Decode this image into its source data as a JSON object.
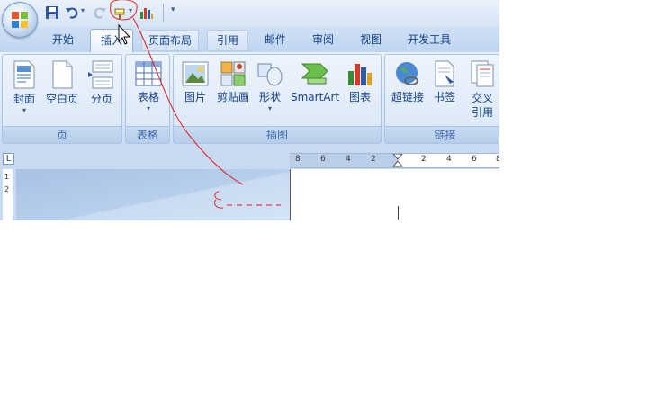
{
  "quick_access": {
    "icons": [
      "save-icon",
      "undo-icon",
      "redo-icon",
      "format-painter-icon",
      "chart-icon",
      "customize-icon"
    ]
  },
  "tabs": [
    {
      "label": "开始"
    },
    {
      "label": "插入"
    },
    {
      "label": "页面布局"
    },
    {
      "label": "引用"
    },
    {
      "label": "邮件"
    },
    {
      "label": "审阅"
    },
    {
      "label": "视图"
    },
    {
      "label": "开发工具"
    }
  ],
  "active_tab": "插入",
  "groups": {
    "pages": {
      "label": "页",
      "buttons": [
        {
          "label": "封面"
        },
        {
          "label": "空白页"
        },
        {
          "label": "分页"
        }
      ]
    },
    "tables": {
      "label": "表格",
      "buttons": [
        {
          "label": "表格"
        }
      ]
    },
    "illustrations": {
      "label": "插图",
      "buttons": [
        {
          "label": "图片"
        },
        {
          "label": "剪贴画"
        },
        {
          "label": "形状"
        },
        {
          "label": "SmartArt"
        },
        {
          "label": "图表"
        }
      ]
    },
    "links": {
      "label": "链接",
      "buttons": [
        {
          "label": "超链接"
        },
        {
          "label": "书签"
        },
        {
          "label": "交叉"
        }
      ],
      "crossref_second_line": "引用"
    }
  },
  "ruler": {
    "corner_glyph": "L",
    "ticks": [
      "8",
      "6",
      "4",
      "2",
      "2",
      "4",
      "6",
      "8"
    ],
    "vertical_ticks": [
      "1",
      "2"
    ]
  },
  "colors": {
    "ribbon_text": "#15428b",
    "annotation": "#e02020"
  }
}
